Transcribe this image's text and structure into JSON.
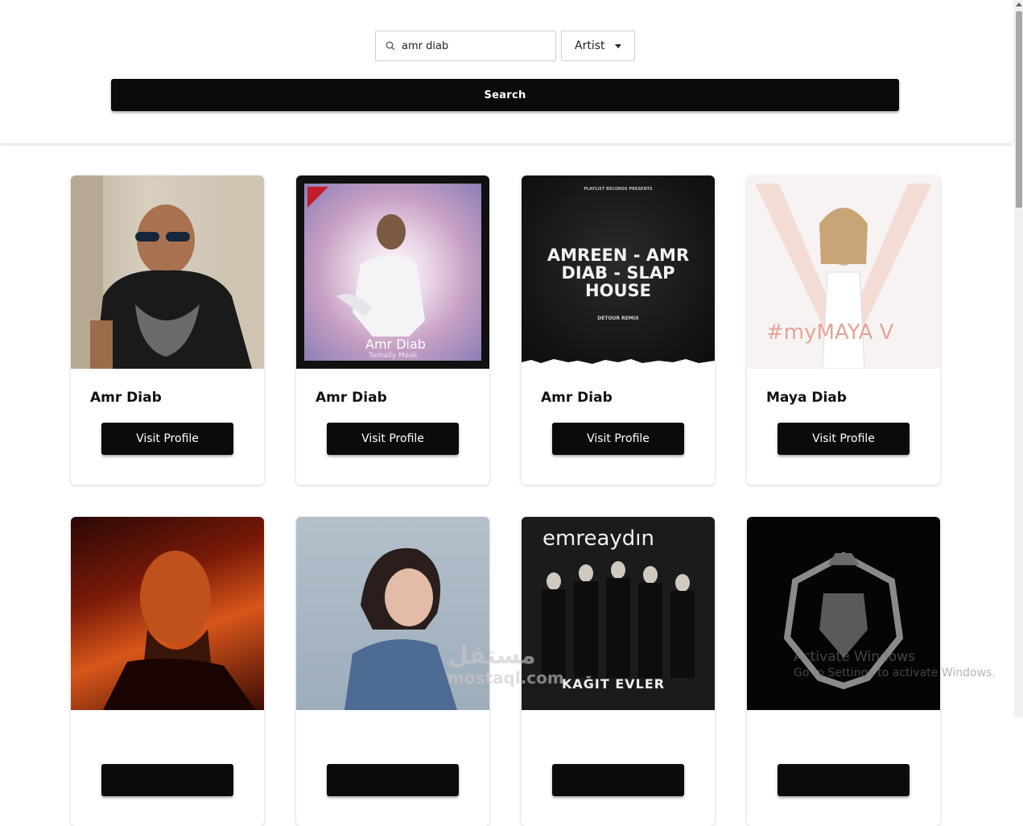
{
  "search": {
    "query": "amr diab",
    "type_selected": "Artist",
    "button_label": "Search"
  },
  "results": [
    {
      "name": "Amr Diab",
      "button": "Visit Profile"
    },
    {
      "name": "Amr Diab",
      "button": "Visit Profile",
      "art_text": "Amr Diab",
      "art_sub": "Tamally Maak"
    },
    {
      "name": "Amr Diab",
      "button": "Visit Profile",
      "art_top": "PLAYLIST RECORDS PRESENTS",
      "art_title": "AMREEN - AMR DIAB - SLAP HOUSE",
      "art_sub": "DETOUR REMIX"
    },
    {
      "name": "Maya Diab",
      "button": "Visit Profile",
      "art_text": "#myMAYA V"
    },
    {
      "name": "",
      "button": ""
    },
    {
      "name": "",
      "button": ""
    },
    {
      "name": "",
      "button": "",
      "art_title": "emreaydın",
      "art_sub": "KAĞIT EVLER"
    },
    {
      "name": "",
      "button": ""
    }
  ],
  "overlays": {
    "windows_line1": "Activate Windows",
    "windows_line2": "Go to Settings to activate Windows.",
    "site_ar": "مستقل",
    "site_en": "mostaql.com"
  },
  "colors": {
    "button_bg": "#0b0b0b",
    "button_text": "#ffffff",
    "page_bg": "#ffffff"
  }
}
